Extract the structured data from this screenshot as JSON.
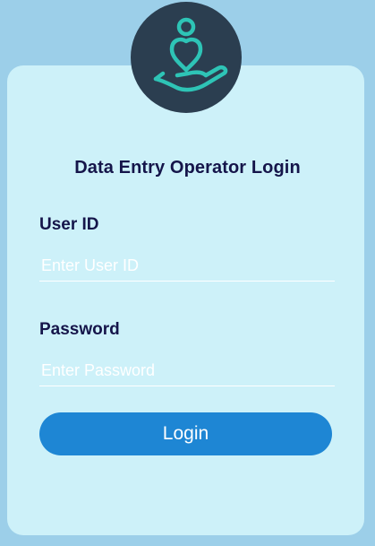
{
  "logo": {
    "icon": "heart-in-hand-icon",
    "background_color": "#2b3e50",
    "stroke_color": "#2ec4b6"
  },
  "login_form": {
    "title": "Data Entry Operator Login",
    "user_id": {
      "label": "User ID",
      "placeholder": "Enter User ID",
      "value": ""
    },
    "password": {
      "label": "Password",
      "placeholder": "Enter Password",
      "value": ""
    },
    "login_button": "Login"
  },
  "colors": {
    "page_background": "#9ccfe9",
    "card_background": "#cdf1f9",
    "button": "#1e86d4",
    "text": "#15154a"
  }
}
